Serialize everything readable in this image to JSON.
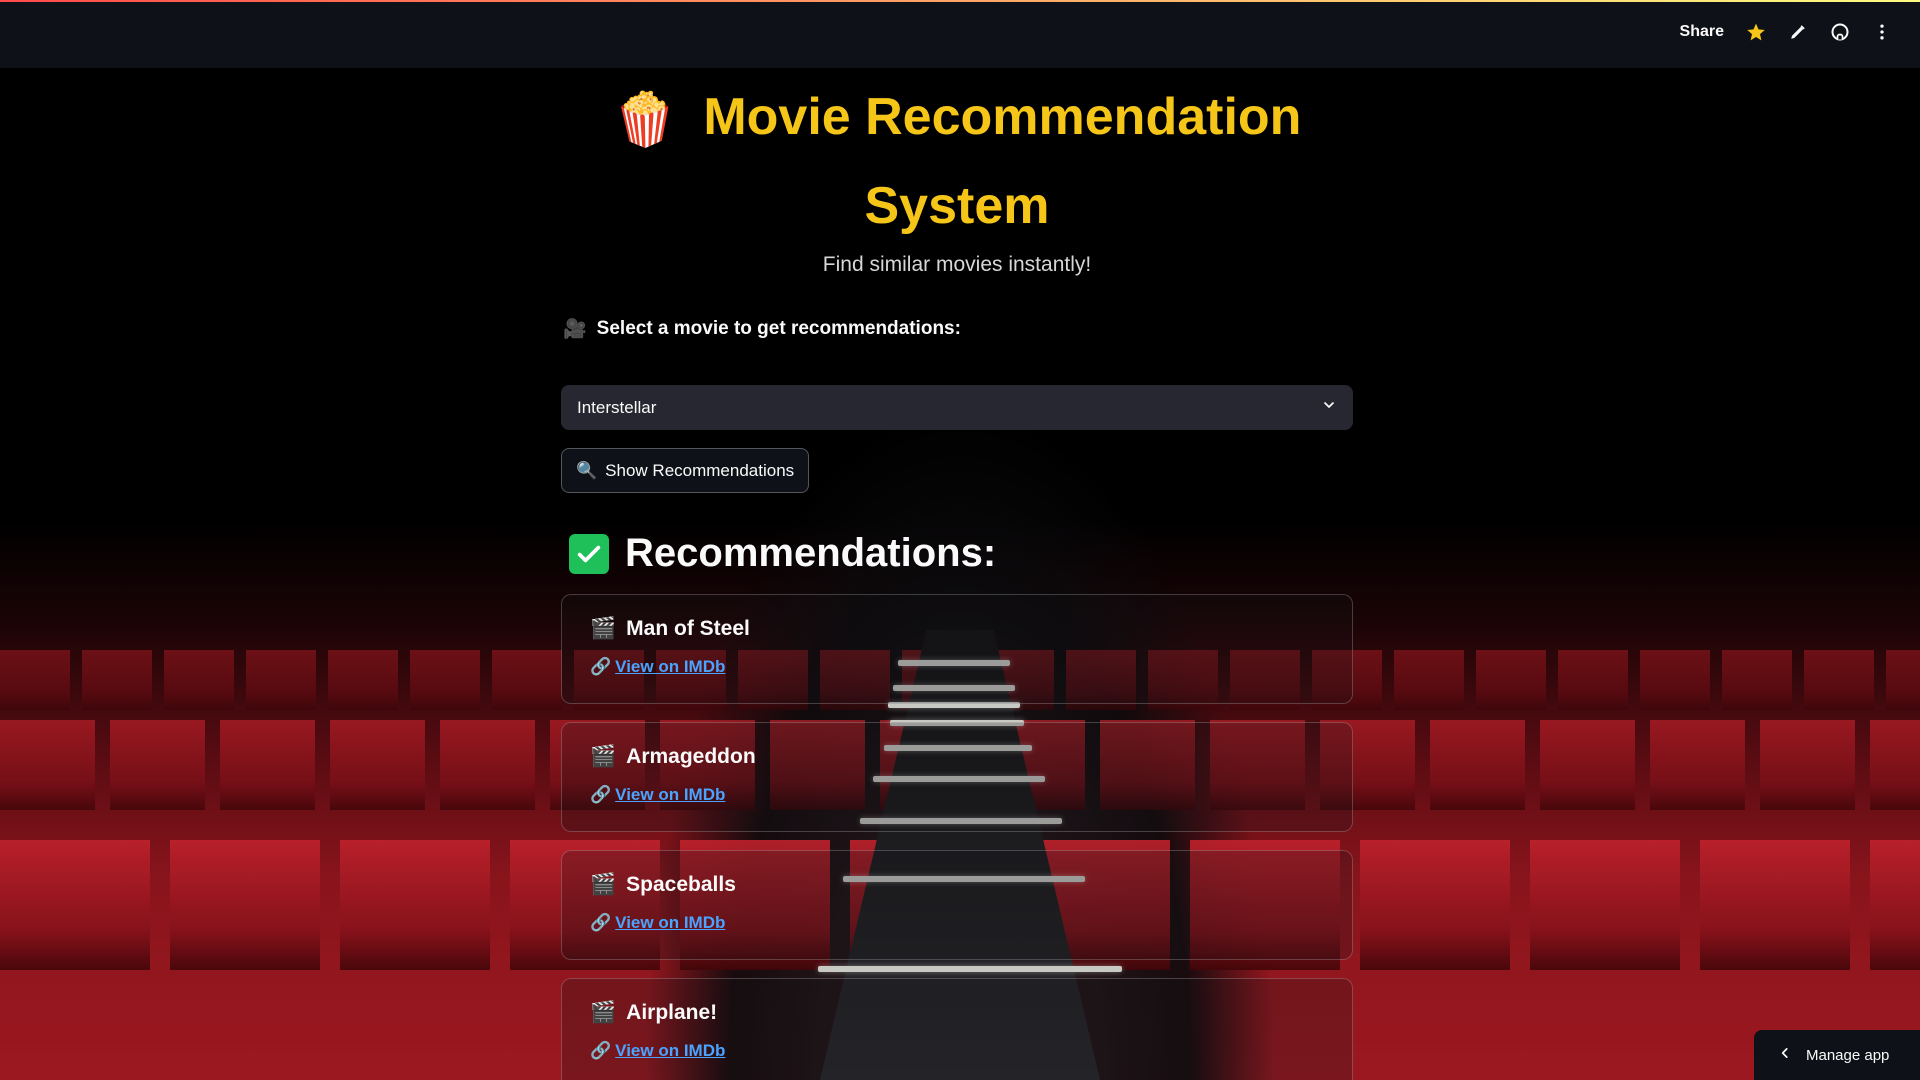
{
  "header": {
    "share_label": "Share",
    "icons": [
      "star-icon",
      "pencil-icon",
      "github-icon",
      "more-vertical-icon"
    ],
    "accent_gradient": [
      "#ff4b4b",
      "#fffd80"
    ]
  },
  "main": {
    "title_emoji": "🍿",
    "title": "Movie Recommendation System",
    "subtitle": "Find similar movies instantly!",
    "select_label_emoji": "🎥",
    "select_label": "Select a movie to get recommendations:",
    "selected_movie": "Interstellar",
    "show_button_emoji": "🔍",
    "show_button_label": "Show Recommendations",
    "recommendations_heading": "Recommendations:",
    "recommendations": [
      {
        "emoji": "🎬",
        "title": "Man of Steel",
        "link_emoji": "🔗",
        "link_label": "View on IMDb"
      },
      {
        "emoji": "🎬",
        "title": "Armageddon",
        "link_emoji": "🔗",
        "link_label": "View on IMDb"
      },
      {
        "emoji": "🎬",
        "title": "Spaceballs",
        "link_emoji": "🔗",
        "link_label": "View on IMDb"
      },
      {
        "emoji": "🎬",
        "title": "Airplane!",
        "link_emoji": "🔗",
        "link_label": "View on IMDb"
      }
    ]
  },
  "footer": {
    "manage_app_label": "Manage app"
  },
  "colors": {
    "title": "#f5c518",
    "link": "#4aa3ff",
    "check": "#1fc05a",
    "select_bg": "#262730",
    "header_bg": "#0e1117"
  }
}
